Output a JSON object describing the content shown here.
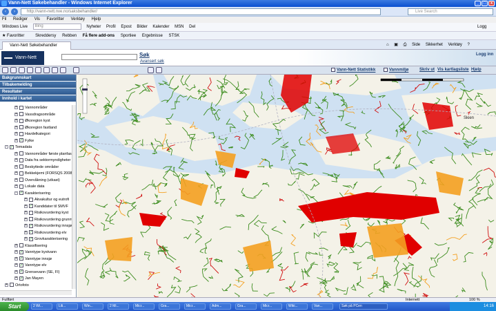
{
  "window": {
    "title": "Vann-Nett Søkebehandler - Windows Internet Explorer"
  },
  "browser": {
    "address": "http://vann-nett.nve.no/saksbehandler/",
    "search_placeholder": "Live Search",
    "menu": [
      "Fil",
      "Rediger",
      "Vis",
      "Favoritter",
      "Verktøy",
      "Hjelp"
    ],
    "toolbar": [
      "Windows Live",
      "Bing",
      "Nyheter",
      "Profil",
      "Epost",
      "Bilder",
      "Kalender",
      "MSN",
      "Del"
    ],
    "toolbar_right": "Logg på",
    "favorites": [
      "Favoritter",
      "Skreddersy",
      "Rebben",
      "Få flere add-ons",
      "Sportiee",
      "Ergebnisse",
      "STSK"
    ],
    "tab_label": "Vann-Nett Søkebehandler",
    "tab_commands": [
      "Side",
      "Sikkerhet",
      "Verktøy"
    ]
  },
  "app": {
    "logo": "Vann-Nett",
    "search_button": "Søk",
    "advanced_search": "Avansert søk",
    "login": "Logg inn",
    "map_toolbar": {
      "checkbox_stat": "Vann-Nett Statistikk",
      "checkbox_vannmiljo": "Vannmiljø",
      "links": [
        "Skriv ut",
        "Vis kartlagsliste",
        "Hjelp"
      ]
    }
  },
  "sidebar": {
    "sections": [
      "Bakgrunnskart",
      "Tilbakemelding",
      "Resultater",
      "Innhold i kartet"
    ],
    "tree": [
      {
        "label": "Vannområder",
        "indent": 3,
        "checked": false,
        "expander": "+"
      },
      {
        "label": "Vassdragsområde",
        "indent": 3,
        "checked": false,
        "expander": "+"
      },
      {
        "label": "Økoregion kyst",
        "indent": 3,
        "checked": false,
        "expander": "+"
      },
      {
        "label": "Økoregion fastland",
        "indent": 3,
        "checked": false,
        "expander": "+"
      },
      {
        "label": "Havdelkategori",
        "indent": 3,
        "checked": false,
        "expander": "+"
      },
      {
        "label": "Fylke",
        "indent": 3,
        "checked": true,
        "expander": "+"
      },
      {
        "label": "Temadata",
        "indent": 1,
        "checked": true,
        "expander": "-"
      },
      {
        "label": "Vannområder første planfase",
        "indent": 3,
        "checked": false,
        "expander": "+"
      },
      {
        "label": "Data fra sektormyndigheter",
        "indent": 3,
        "checked": false,
        "expander": "+"
      },
      {
        "label": "Beskyttede områder",
        "indent": 3,
        "checked": false,
        "expander": "+"
      },
      {
        "label": "Bekkekjemi (FORSQS 2008)",
        "indent": 3,
        "checked": false,
        "expander": "+"
      },
      {
        "label": "Overvåkning (utkast)",
        "indent": 3,
        "checked": false,
        "expander": "+"
      },
      {
        "label": "Lokale data",
        "indent": 3,
        "checked": false,
        "expander": "+"
      },
      {
        "label": "Karakterisering",
        "indent": 3,
        "checked": true,
        "expander": "-"
      },
      {
        "label": "Akvakultur og eutrofi",
        "indent": 5,
        "checked": false,
        "expander": "+"
      },
      {
        "label": "Kandidater til SMVF",
        "indent": 5,
        "checked": true,
        "expander": "+"
      },
      {
        "label": "Risikovurdering kyst",
        "indent": 5,
        "checked": false,
        "expander": "+"
      },
      {
        "label": "Risikovurdering grunnvann",
        "indent": 5,
        "checked": false,
        "expander": "+"
      },
      {
        "label": "Risikovurdering innsjø",
        "indent": 5,
        "checked": true,
        "expander": "+"
      },
      {
        "label": "Risikovurdering elv",
        "indent": 5,
        "checked": true,
        "expander": "+"
      },
      {
        "label": "Grovkarakterisering",
        "indent": 5,
        "checked": true,
        "expander": "+"
      },
      {
        "label": "Klassifisering",
        "indent": 3,
        "checked": false,
        "expander": "+"
      },
      {
        "label": "Vanntype kystvann",
        "indent": 3,
        "checked": true,
        "expander": "+"
      },
      {
        "label": "Vanntype innsjø",
        "indent": 3,
        "checked": true,
        "expander": "+"
      },
      {
        "label": "Vanntype elv",
        "indent": 3,
        "checked": true,
        "expander": "+"
      },
      {
        "label": "Grensevann (SE, FI)",
        "indent": 3,
        "checked": true,
        "expander": "+"
      },
      {
        "label": "Jan Mayen",
        "indent": 3,
        "checked": true,
        "expander": "+"
      },
      {
        "label": "Ortofoto",
        "indent": 1,
        "checked": false,
        "expander": "+"
      }
    ]
  },
  "map": {
    "place_label": "Skien"
  },
  "status": {
    "left": "Fullført",
    "zone": "Internett",
    "zoom": "100 %"
  },
  "taskbar": {
    "start": "Start",
    "tasks": [
      "2 Wi...",
      "Lili...",
      "Win...",
      "2 Mi...",
      "Micr...",
      "Gra...",
      "Micr...",
      "Adm...",
      "Gra...",
      "Micr...",
      "Wiki...",
      "Van..."
    ],
    "search_placeholder": "Søk på PCen",
    "clock": "14:16"
  },
  "colors": {
    "accent": "#2a5f9e",
    "river": "#3c8c1e",
    "risk_red": "#e00000",
    "risk_orange": "#f4a020",
    "water": "#cfe1f2"
  }
}
